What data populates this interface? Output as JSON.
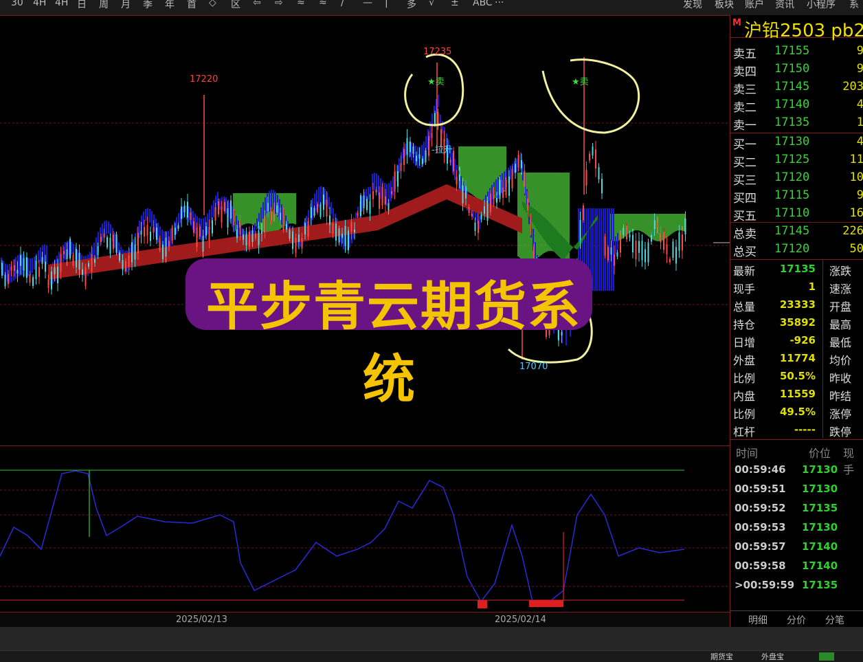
{
  "toolbar": {
    "left_items": [
      "30",
      "4H",
      "4H",
      "日",
      "周",
      "月",
      "季",
      "年",
      "首",
      "◇",
      "区",
      "⇦",
      "⇨",
      "≈",
      "≈",
      "/",
      "—",
      "|",
      "多",
      "√",
      "±",
      "ABC",
      "···"
    ],
    "right_items": [
      "发现",
      "板块",
      "账户",
      "资讯",
      "小程序",
      "系"
    ]
  },
  "chart": {
    "high_label_1": "17220",
    "high_label_2": "17235",
    "low_label": "17070",
    "sell_marker_1": "★卖",
    "sell_marker_2": "★卖",
    "pull_marker": "-拉升"
  },
  "banner": {
    "line1": "平步青云期货系",
    "line2": "统"
  },
  "date_axis": {
    "date1": "2025/02/13",
    "date2": "2025/02/14"
  },
  "panel": {
    "marker": "M",
    "symbol": "沪铅2503  pb2",
    "asks": [
      {
        "label": "卖五",
        "price": "17155",
        "vol": "9"
      },
      {
        "label": "卖四",
        "price": "17150",
        "vol": "9"
      },
      {
        "label": "卖三",
        "price": "17145",
        "vol": "203"
      },
      {
        "label": "卖二",
        "price": "17140",
        "vol": "4"
      },
      {
        "label": "卖一",
        "price": "17135",
        "vol": "1"
      }
    ],
    "bids": [
      {
        "label": "买一",
        "price": "17130",
        "vol": "4"
      },
      {
        "label": "买二",
        "price": "17125",
        "vol": "11"
      },
      {
        "label": "买三",
        "price": "17120",
        "vol": "10"
      },
      {
        "label": "买四",
        "price": "17115",
        "vol": "9"
      },
      {
        "label": "买五",
        "price": "17110",
        "vol": "16"
      }
    ],
    "totals": [
      {
        "label": "总卖",
        "price": "17145",
        "vol": "226"
      },
      {
        "label": "总买",
        "price": "17120",
        "vol": "50"
      }
    ],
    "quote": [
      {
        "label": "最新",
        "value": "17135",
        "color": "#2ed12e",
        "label2": "涨跌"
      },
      {
        "label": "现手",
        "value": "1",
        "color": "#e0e000",
        "label2": "速涨"
      },
      {
        "label": "总量",
        "value": "23333",
        "color": "#e0e000",
        "label2": "开盘"
      },
      {
        "label": "持仓",
        "value": "35892",
        "color": "#e0e000",
        "label2": "最高"
      },
      {
        "label": "日增",
        "value": "-926",
        "color": "#e0e000",
        "label2": "最低"
      },
      {
        "label": "外盘",
        "value": "11774",
        "color": "#e0e000",
        "label2": "均价"
      },
      {
        "label": "比例",
        "value": "50.5%",
        "color": "#e0e000",
        "label2": "昨收"
      },
      {
        "label": "内盘",
        "value": "11559",
        "color": "#e0e000",
        "label2": "昨结"
      },
      {
        "label": "比例",
        "value": "49.5%",
        "color": "#e0e000",
        "label2": "涨停"
      },
      {
        "label": "杠杆",
        "value": "-----",
        "color": "#e0e000",
        "label2": "跌停"
      }
    ],
    "ticks_header": {
      "time": "时间",
      "price": "价位",
      "vol": "现手"
    },
    "ticks": [
      {
        "time": "00:59:46",
        "price": "17130"
      },
      {
        "time": "00:59:51",
        "price": "17130"
      },
      {
        "time": "00:59:52",
        "price": "17135"
      },
      {
        "time": "00:59:53",
        "price": "17130"
      },
      {
        "time": "00:59:57",
        "price": "17140"
      },
      {
        "time": "00:59:58",
        "price": "17140"
      },
      {
        "time": ">00:59:59",
        "price": "17135"
      }
    ],
    "tabs": [
      "明细",
      "分价",
      "分笔"
    ]
  },
  "status": {
    "btn1": "期货宝",
    "btn2": "外盘宝"
  }
}
